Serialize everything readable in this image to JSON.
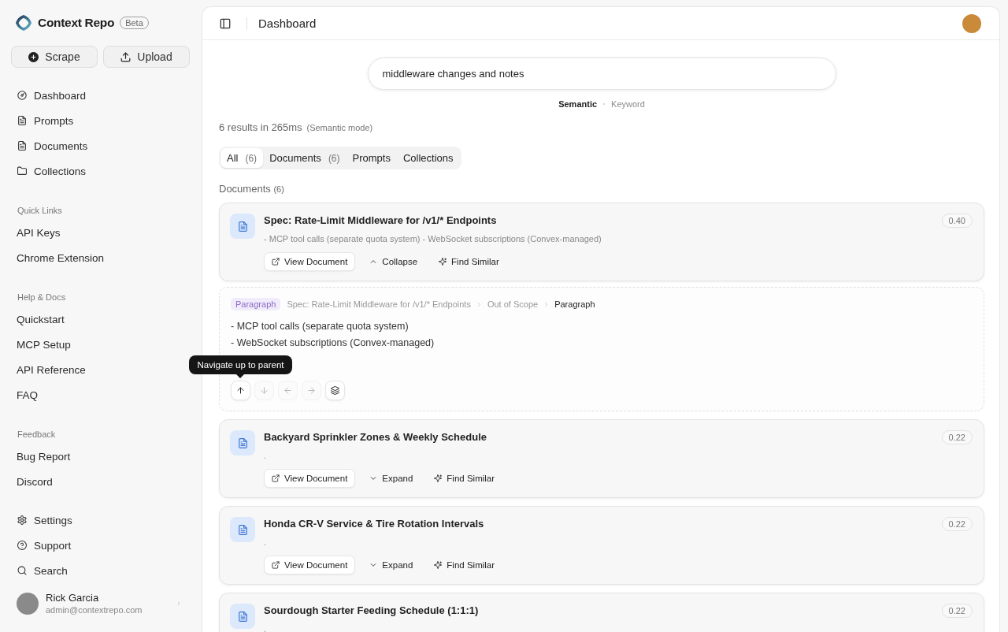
{
  "sidebar": {
    "brand": {
      "name": "Context Repo",
      "badge": "Beta"
    },
    "actions": [
      {
        "kind": "scrape",
        "label": "Scrape"
      },
      {
        "kind": "upload",
        "label": "Upload"
      }
    ],
    "nav": [
      {
        "kind": "dashboard",
        "label": "Dashboard"
      },
      {
        "kind": "prompts",
        "label": "Prompts"
      },
      {
        "kind": "documents",
        "label": "Documents"
      },
      {
        "kind": "collections",
        "label": "Collections"
      }
    ],
    "sections": [
      {
        "title": "Quick Links",
        "items": [
          {
            "label": "API Keys"
          },
          {
            "label": "Chrome Extension"
          }
        ]
      },
      {
        "title": "Help & Docs",
        "items": [
          {
            "label": "Quickstart"
          },
          {
            "label": "MCP Setup"
          },
          {
            "label": "API Reference"
          },
          {
            "label": "FAQ"
          }
        ]
      },
      {
        "title": "Feedback",
        "items": [
          {
            "label": "Bug Report"
          },
          {
            "label": "Discord"
          }
        ]
      }
    ],
    "footer_nav": [
      {
        "kind": "settings",
        "label": "Settings"
      },
      {
        "kind": "support",
        "label": "Support"
      },
      {
        "kind": "search",
        "label": "Search"
      }
    ],
    "user": {
      "name": "Rick Garcia",
      "email": "admin@contextrepo.com"
    }
  },
  "header": {
    "title": "Dashboard"
  },
  "search": {
    "value": "middleware changes and notes",
    "modes": [
      {
        "label": "Semantic",
        "selected": true
      },
      {
        "label": "Keyword",
        "selected": false
      }
    ]
  },
  "summary": {
    "text": "6 results in 265ms",
    "note": "(Semantic mode)"
  },
  "tabs": [
    {
      "label": "All",
      "count": "(6)",
      "selected": true
    },
    {
      "label": "Documents",
      "count": "(6)",
      "selected": false
    },
    {
      "label": "Prompts",
      "selected": false
    },
    {
      "label": "Collections",
      "selected": false
    }
  ],
  "results": {
    "title": "Documents",
    "count": "(6)",
    "items": [
      {
        "kind": "document",
        "title": "Spec: Rate-Limit Middleware for /v1/* Endpoints",
        "snippet": "- MCP tool calls (separate quota system) - WebSocket subscriptions (Convex-managed)",
        "score": "0.40",
        "actions": [
          {
            "kind": "view",
            "label": "View Document"
          },
          {
            "kind": "toggle",
            "label": "Collapse",
            "expanded": true
          },
          {
            "kind": "similar",
            "label": "Find Similar"
          }
        ]
      },
      {
        "kind": "chunk",
        "badge": "Paragraph",
        "breadcrumb": [
          {
            "label": "Spec: Rate-Limit Middleware for /v1/* Endpoints",
            "current": false
          },
          {
            "label": "Out of Scope",
            "current": false
          },
          {
            "label": "Paragraph",
            "current": true
          }
        ],
        "lines": [
          "- MCP tool calls (separate quota system)",
          "- WebSocket subscriptions (Convex-managed)"
        ],
        "controls": [
          {
            "kind": "up",
            "disabled": false,
            "tooltip": "Navigate up to parent"
          },
          {
            "kind": "down",
            "disabled": true
          },
          {
            "kind": "left",
            "disabled": true
          },
          {
            "kind": "right",
            "disabled": true
          },
          {
            "kind": "layers",
            "disabled": false
          }
        ]
      },
      {
        "kind": "document",
        "title": "Backyard Sprinkler Zones & Weekly Schedule",
        "snippet": ".",
        "score": "0.22",
        "actions": [
          {
            "kind": "view",
            "label": "View Document"
          },
          {
            "kind": "toggle",
            "label": "Expand",
            "expanded": false
          },
          {
            "kind": "similar",
            "label": "Find Similar"
          }
        ]
      },
      {
        "kind": "document",
        "title": "Honda CR-V Service & Tire Rotation Intervals",
        "snippet": ".",
        "score": "0.22",
        "actions": [
          {
            "kind": "view",
            "label": "View Document"
          },
          {
            "kind": "toggle",
            "label": "Expand",
            "expanded": false
          },
          {
            "kind": "similar",
            "label": "Find Similar"
          }
        ]
      },
      {
        "kind": "document",
        "title": "Sourdough Starter Feeding Schedule (1:1:1)",
        "snippet": ".",
        "score": "0.22"
      }
    ]
  }
}
